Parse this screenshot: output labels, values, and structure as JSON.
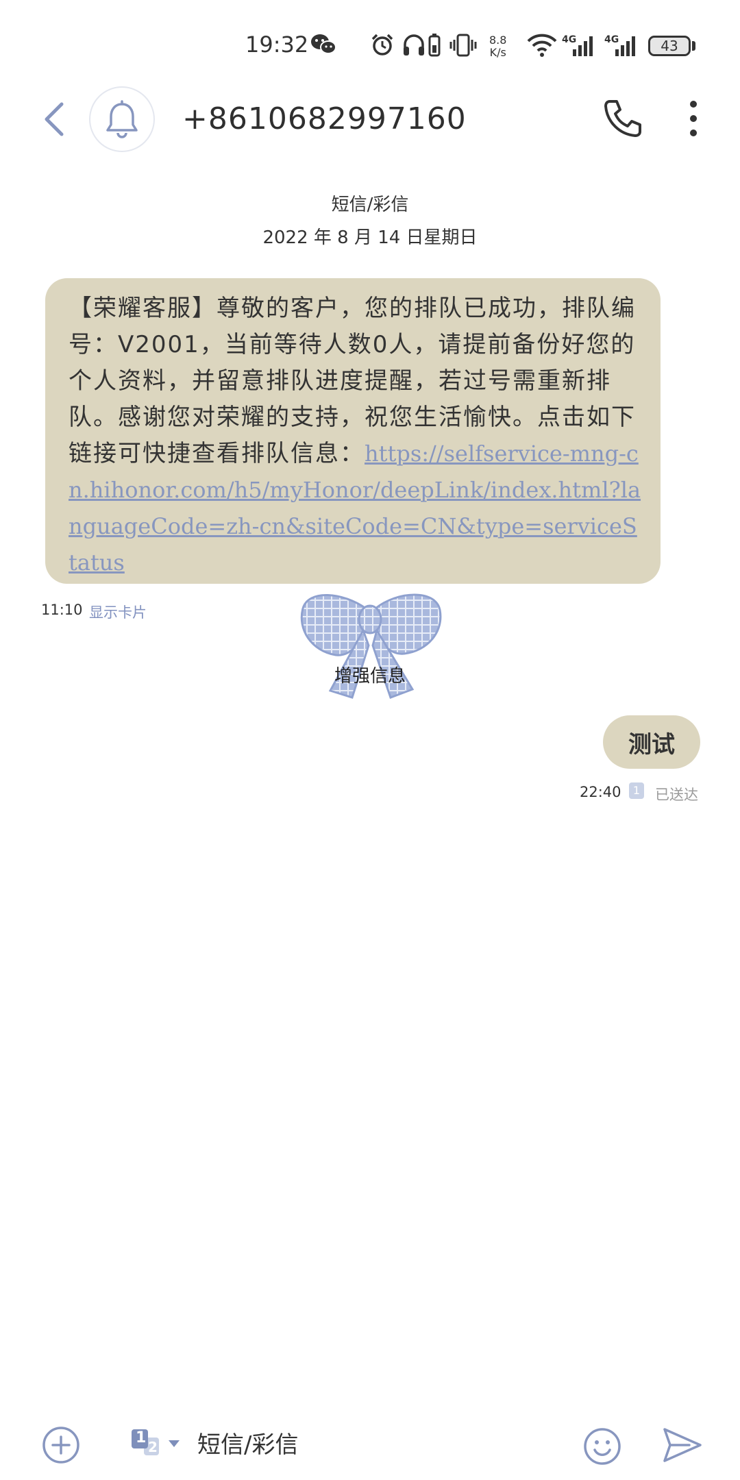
{
  "status_bar": {
    "time": "19:32",
    "net_speed_value": "8.8",
    "net_speed_unit": "K/s",
    "signal_1_label": "4G",
    "signal_2_label": "4G",
    "battery": "43",
    "icons": [
      "wechat-icon",
      "alarm-icon",
      "headphones-icon",
      "battery-saver-icon",
      "vibrate-icon",
      "wifi-icon",
      "signal-icon",
      "battery-icon"
    ]
  },
  "header": {
    "contact": "+8610682997160",
    "icons": [
      "back-icon",
      "bell-icon",
      "phone-icon",
      "more-icon"
    ]
  },
  "conversation": {
    "channel": "短信/彩信",
    "date": "2022 年 8 月 14 日星期日",
    "incoming": {
      "text": "【荣耀客服】尊敬的客户，您的排队已成功，排队编号：V2001，当前等待人数0人，请提前备份好您的个人资料，并留意排队进度提醒，若过号需重新排队。感谢您对荣耀的支持，祝您生活愉快。点击如下链接可快捷查看排队信息：",
      "link": "https://selfservice-mng-cn.hihonor.com/h5/myHonor/deepLink/index.html?languageCode=zh-cn&siteCode=CN&type=serviceStatus",
      "time": "11:10",
      "show_card": "显示卡片"
    },
    "enhanced_label": "增强信息",
    "outgoing": {
      "text": "测试",
      "time": "22:40",
      "sim": "1",
      "status": "已送达"
    }
  },
  "composer": {
    "placeholder": "短信/彩信",
    "sim_primary": "1",
    "sim_secondary": "2",
    "icons": [
      "add-icon",
      "sim-switch-icon",
      "emoji-icon",
      "send-icon"
    ]
  },
  "colors": {
    "bubble": "#dcd6bf",
    "accent": "#8796bf",
    "bow": "#a9b8dd"
  }
}
